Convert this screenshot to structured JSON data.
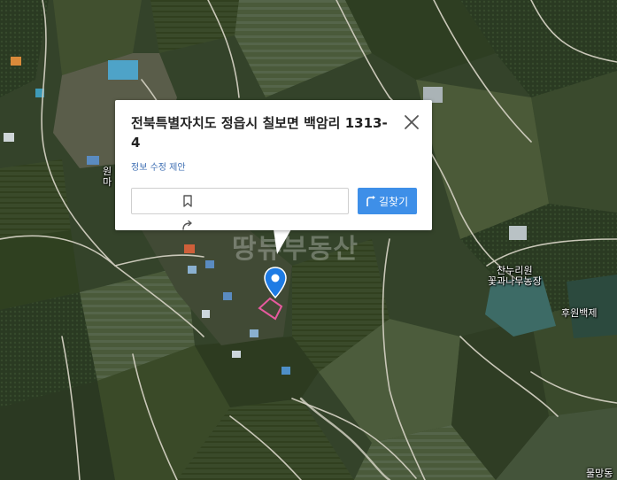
{
  "popup": {
    "title": "전북특별자치도 정읍시 칠보면 백암리 1313-4",
    "edit_link": "정보 수정 제안",
    "route_button": "길찾기",
    "icons": [
      "bookmark-icon",
      "share-icon",
      "route-arrow-icon",
      "close-icon"
    ]
  },
  "map": {
    "watermark": "땅뷰부동산",
    "labels": {
      "farm": "찬누리원\n꽃과나무농장",
      "cemetery": "후원백제",
      "village": "원\n마",
      "bottom_right": "물망동"
    },
    "colors": {
      "pin": "#1e7be4",
      "parcel_outline": "#e65a9e",
      "route_button": "#3e8fe8"
    }
  }
}
